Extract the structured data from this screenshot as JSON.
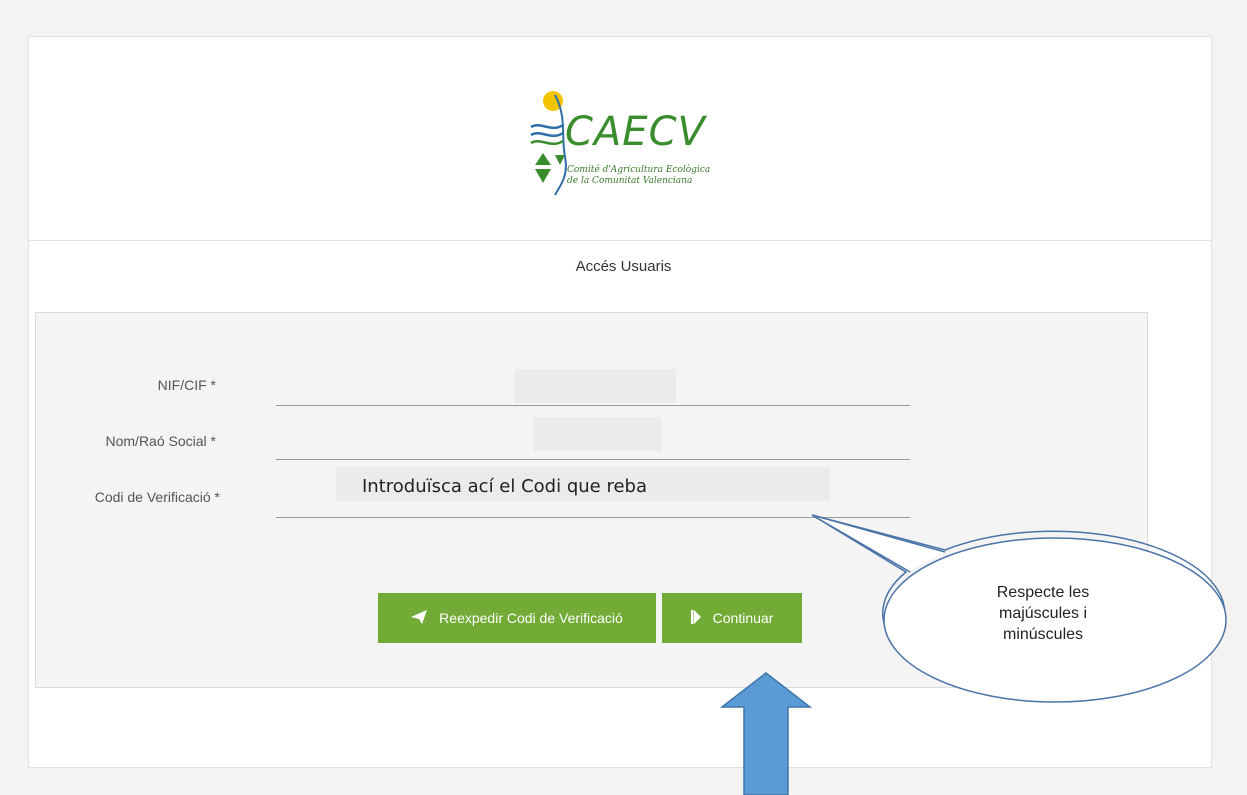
{
  "logo": {
    "title": "CAECV",
    "subtitle_line1": "Comité d'Agricultura Ecològica",
    "subtitle_line2": "de la Comunitat Valenciana",
    "sun_color": "#f5c400",
    "green_color": "#3a8d2c",
    "wave_color": "#2e6fa8"
  },
  "page": {
    "title": "Accés Usuaris"
  },
  "form": {
    "nif_label": "NIF/CIF *",
    "name_label": "Nom/Raó Social *",
    "code_label": "Codi de Verificació *",
    "code_value": "Introduïsca ací el Codi que reba"
  },
  "buttons": {
    "resend_label": "Reexpedir Codi de Verificació",
    "resend_icon": "paper-plane-icon",
    "continue_label": "Continuar",
    "continue_icon": "skip-forward-icon",
    "color": "#72ab36"
  },
  "annotation": {
    "callout_line1": "Respecte les",
    "callout_line2": "majúscules i",
    "callout_line3": "minúscules",
    "arrow_color": "#5b9bd5"
  }
}
